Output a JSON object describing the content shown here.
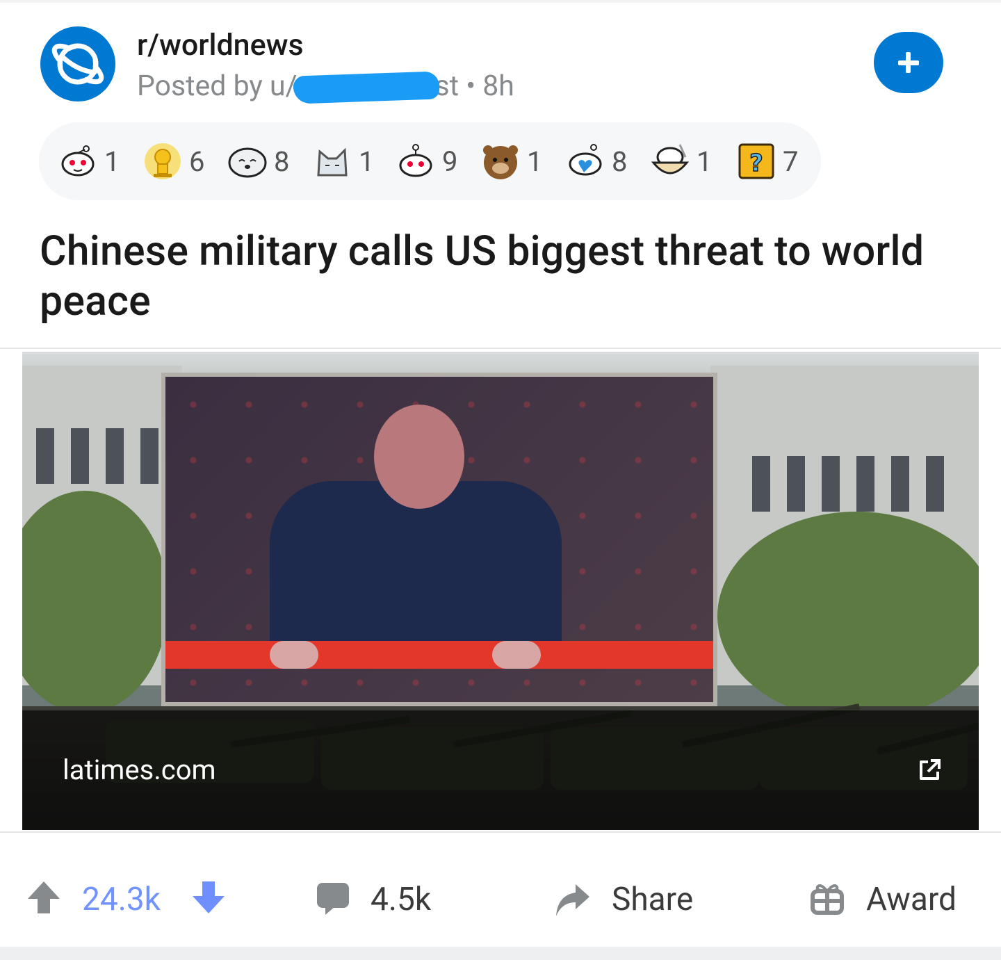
{
  "post": {
    "subreddit": "r/worldnews",
    "posted_prefix": "Posted by u/",
    "posted_suffix": "st • 8h",
    "title": "Chinese military calls US biggest threat to world peace",
    "link_domain": "latimes.com"
  },
  "awards": [
    {
      "icon": "award-snoo-heart-icon",
      "count": "1"
    },
    {
      "icon": "award-helpful-gold-icon",
      "count": "6"
    },
    {
      "icon": "award-seal-icon",
      "count": "8"
    },
    {
      "icon": "award-cat-icon",
      "count": "1"
    },
    {
      "icon": "award-snoo-icon",
      "count": "9"
    },
    {
      "icon": "award-bear-icon",
      "count": "1"
    },
    {
      "icon": "award-snoo-love-icon",
      "count": "8"
    },
    {
      "icon": "award-snoo-bowl-icon",
      "count": "1"
    },
    {
      "icon": "award-question-block-icon",
      "count": "7"
    }
  ],
  "actions": {
    "score": "24.3k",
    "comments": "4.5k",
    "share_label": "Share",
    "award_label": "Award"
  },
  "colors": {
    "accent": "#0079d3",
    "upvote_active": "#7193ff",
    "muted": "#878a8c",
    "redaction": "#1a9bf5"
  }
}
